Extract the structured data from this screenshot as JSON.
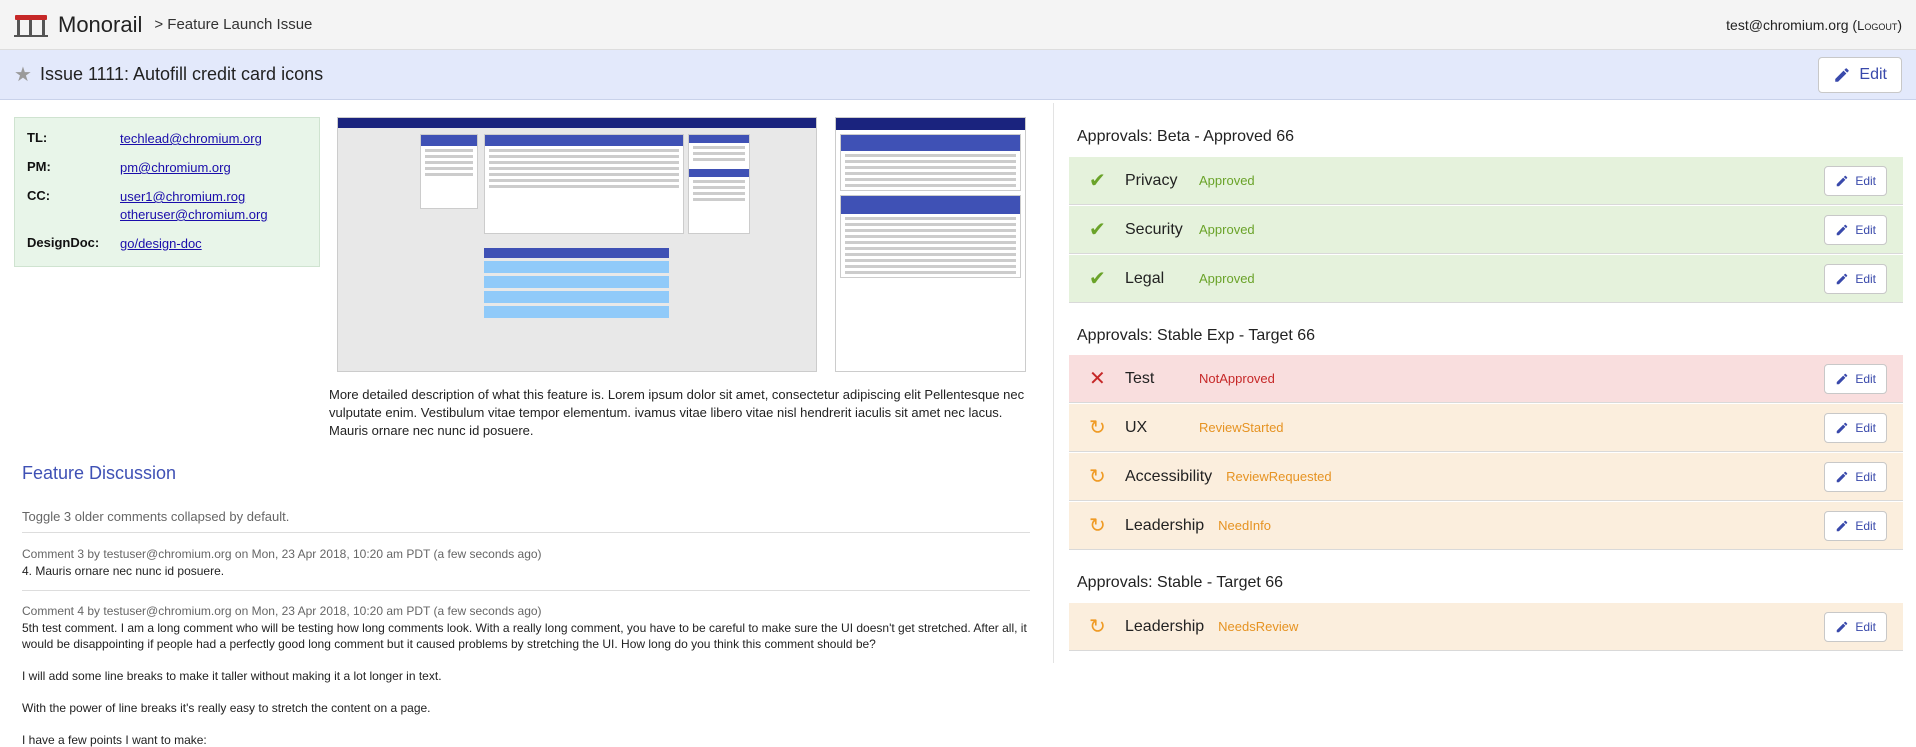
{
  "app": {
    "name": "Monorail",
    "breadcrumb": "> Feature Launch Issue"
  },
  "user": {
    "email": "test@chromium.org",
    "logout_open": " (",
    "logout": "Logout",
    "logout_close": ")"
  },
  "issue": {
    "title": "Issue 1111: Autofill credit card icons",
    "edit_label": "Edit"
  },
  "people": {
    "tl_label": "TL:",
    "tl": "techlead@chromium.org",
    "pm_label": "PM:",
    "pm": "pm@chromium.org",
    "cc_label": "CC:",
    "cc": [
      "user1@chromium.rog",
      "otheruser@chromium.org"
    ],
    "doc_label": "DesignDoc:",
    "doc": "go/design-doc"
  },
  "description": "More detailed description of what this feature is. Lorem ipsum dolor sit amet, consectetur adipiscing elit Pellentesque nec vulputate enim. Vestibulum vitae tempor elementum. ivamus vitae libero vitae nisl hendrerit iaculis sit amet nec lacus. Mauris ornare nec nunc id posuere.",
  "discussion": {
    "title": "Feature Discussion",
    "toggle": "Toggle 3 older comments collapsed by default.",
    "comments": [
      {
        "meta": "Comment 3 by testuser@chromium.org on Mon, 23 Apr 2018, 10:20 am PDT (a few seconds ago)",
        "body": [
          "4. Mauris ornare nec nunc id posuere."
        ]
      },
      {
        "meta": "Comment 4 by testuser@chromium.org on Mon, 23 Apr 2018, 10:20 am PDT (a few seconds ago)",
        "body": [
          "5th test comment. I am a long comment who will be testing how long comments look. With a really long comment, you have to be careful to make sure the UI doesn't get stretched. After all, it would be disappointing if people had a perfectly good long comment but it caused problems by stretching the UI. How long do you think this comment should be?",
          "I will add some line breaks to make it taller without making it a lot longer in text.",
          "With the power of line breaks it's really easy to stretch the content on a page.",
          "I have a few points I want to make:"
        ]
      }
    ]
  },
  "approvals": [
    {
      "title": "Approvals: Beta - Approved 66",
      "rows": [
        {
          "name": "Privacy",
          "status": "Approved",
          "state": "green",
          "icon": "check-icon"
        },
        {
          "name": "Security",
          "status": "Approved",
          "state": "green",
          "icon": "check-icon"
        },
        {
          "name": "Legal",
          "status": "Approved",
          "state": "green",
          "icon": "check-icon"
        }
      ]
    },
    {
      "title": "Approvals: Stable Exp - Target 66",
      "rows": [
        {
          "name": "Test",
          "status": "NotApproved",
          "state": "red",
          "icon": "x-icon"
        },
        {
          "name": "UX",
          "status": "ReviewStarted",
          "state": "orange",
          "icon": "refresh-icon"
        },
        {
          "name": "Accessibility",
          "status": "ReviewRequested",
          "state": "orange",
          "icon": "refresh-icon"
        },
        {
          "name": "Leadership",
          "status": "NeedInfo",
          "state": "orange",
          "icon": "refresh-icon"
        }
      ]
    },
    {
      "title": "Approvals: Stable - Target 66",
      "rows": [
        {
          "name": "Leadership",
          "status": "NeedsReview",
          "state": "orange",
          "icon": "refresh-icon"
        }
      ]
    }
  ],
  "edit_label": "Edit",
  "colors": {
    "accent": "#3f51b5",
    "green": "#6aa329",
    "red": "#c62828",
    "orange": "#ef9b25"
  }
}
